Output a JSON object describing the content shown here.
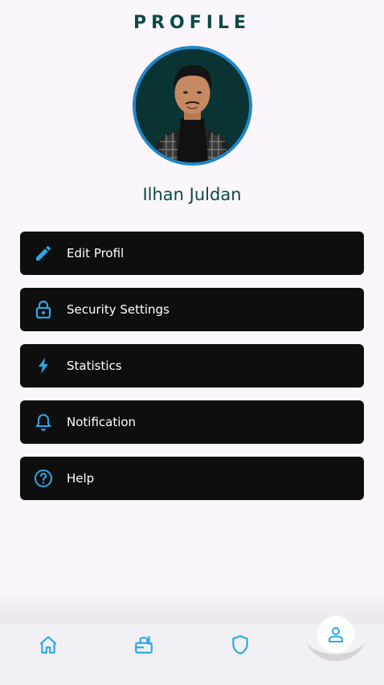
{
  "header": {
    "title": "PROFILE"
  },
  "user": {
    "name": "Ilhan Juldan"
  },
  "menu": {
    "items": [
      {
        "label": "Edit Profil",
        "icon": "pencil-icon"
      },
      {
        "label": "Security Settings",
        "icon": "lock-icon"
      },
      {
        "label": "Statistics",
        "icon": "lightning-icon"
      },
      {
        "label": "Notification",
        "icon": "bell-icon"
      },
      {
        "label": "Help",
        "icon": "help-circle-icon"
      }
    ]
  },
  "bottom_nav": {
    "items": [
      {
        "icon": "home-icon"
      },
      {
        "icon": "shopping-bag-icon"
      },
      {
        "icon": "shield-icon"
      },
      {
        "icon": "person-icon",
        "active": true
      }
    ]
  },
  "colors": {
    "accent": "#2aa8e8",
    "title": "#0c4a4a",
    "menu_bg": "#0e0e0e",
    "page_bg": "#fbf6fb",
    "avatar_ring": "#1f87c8"
  }
}
